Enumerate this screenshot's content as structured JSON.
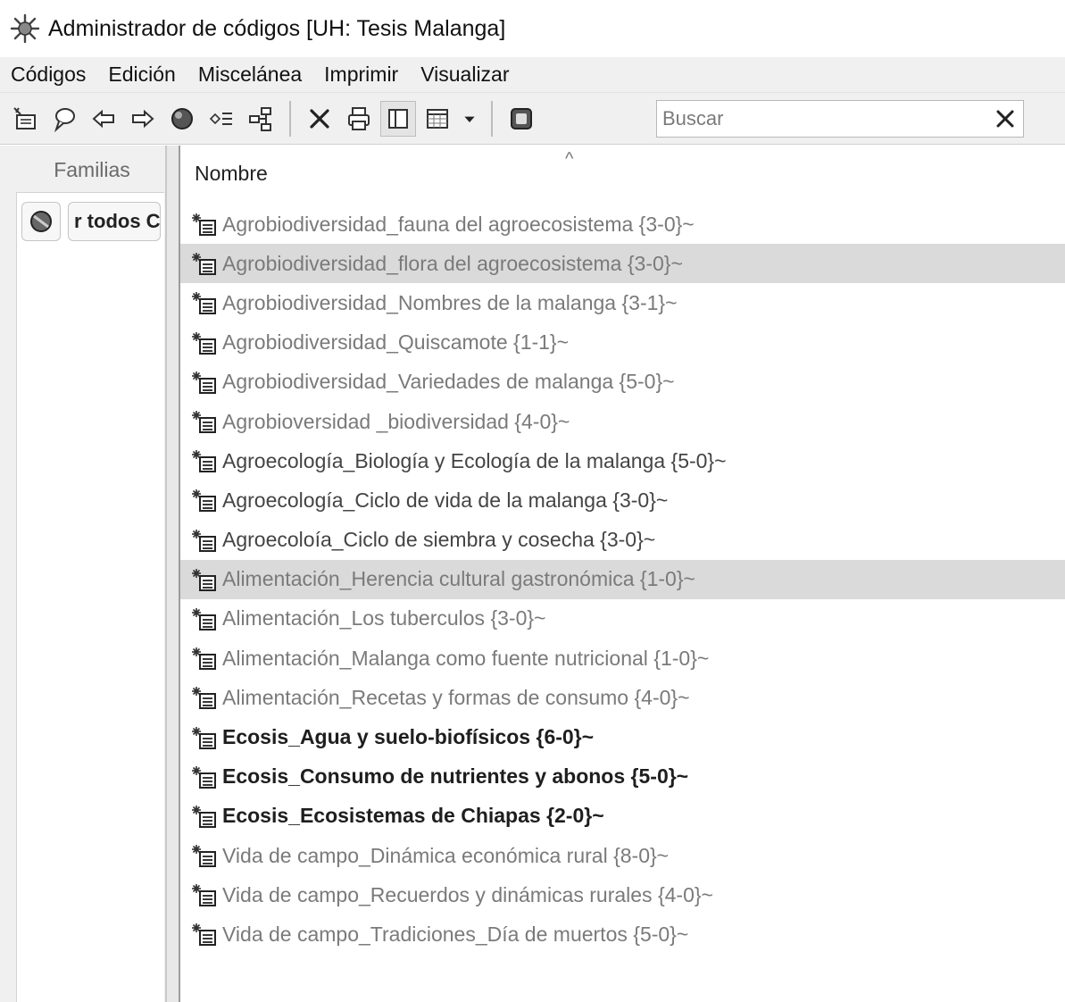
{
  "window": {
    "title": "Administrador de códigos [UH: Tesis Malanga]",
    "icon": "gear-bugs-icon"
  },
  "menu": [
    {
      "label": "Códigos"
    },
    {
      "label": "Edición"
    },
    {
      "label": "Miscelánea"
    },
    {
      "label": "Imprimir"
    },
    {
      "label": "Visualizar"
    }
  ],
  "toolbar": {
    "icons": [
      "new-code-icon",
      "comment-icon",
      "arrow-left-icon",
      "arrow-right-icon",
      "circle-icon",
      "code-list-icon",
      "network-icon",
      "delete-icon",
      "print-icon",
      "split-view-icon",
      "grid-view-icon",
      "dropdown-icon",
      "frame-icon"
    ],
    "search": {
      "placeholder": "Buscar",
      "value": ""
    }
  },
  "families": {
    "header": "Familias",
    "chip_label": "r todos C"
  },
  "codes": {
    "column_header": "Nombre",
    "items": [
      {
        "label": "Agrobiodiversidad_fauna del agroecosistema {3-0}~",
        "style": "gray",
        "selected": false
      },
      {
        "label": "Agrobiodiversidad_flora del agroecosistema {3-0}~",
        "style": "gray",
        "selected": true
      },
      {
        "label": "Agrobiodiversidad_Nombres de la malanga {3-1}~",
        "style": "gray",
        "selected": false
      },
      {
        "label": "Agrobiodiversidad_Quiscamote {1-1}~",
        "style": "gray",
        "selected": false
      },
      {
        "label": "Agrobiodiversidad_Variedades de malanga {5-0}~",
        "style": "gray",
        "selected": false
      },
      {
        "label": "Agrobioversidad _biodiversidad {4-0}~",
        "style": "gray",
        "selected": false
      },
      {
        "label": "Agroecología_Biología y Ecología de la malanga {5-0}~",
        "style": "dark",
        "selected": false
      },
      {
        "label": "Agroecología_Ciclo de vida de la malanga {3-0}~",
        "style": "dark",
        "selected": false
      },
      {
        "label": "Agroecoloía_Ciclo de siembra y cosecha {3-0}~",
        "style": "dark",
        "selected": false
      },
      {
        "label": "Alimentación_Herencia cultural gastronómica {1-0}~",
        "style": "gray",
        "selected": true
      },
      {
        "label": "Alimentación_Los tuberculos {3-0}~",
        "style": "gray",
        "selected": false
      },
      {
        "label": "Alimentación_Malanga como fuente nutricional {1-0}~",
        "style": "gray",
        "selected": false
      },
      {
        "label": "Alimentación_Recetas y formas de consumo {4-0}~",
        "style": "gray",
        "selected": false
      },
      {
        "label": "Ecosis_Agua y suelo-biofísicos {6-0}~",
        "style": "bold",
        "selected": false
      },
      {
        "label": "Ecosis_Consumo de nutrientes y abonos {5-0}~",
        "style": "bold",
        "selected": false
      },
      {
        "label": "Ecosis_Ecosistemas de Chiapas {2-0}~",
        "style": "bold",
        "selected": false
      },
      {
        "label": "Vida de campo_Dinámica económica rural {8-0}~",
        "style": "gray",
        "selected": false
      },
      {
        "label": "Vida de campo_Recuerdos y dinámicas rurales {4-0}~",
        "style": "gray",
        "selected": false
      },
      {
        "label": "Vida de campo_Tradiciones_Día de muertos {5-0}~",
        "style": "gray",
        "selected": false
      }
    ]
  },
  "colors": {
    "selected_row": "#dadada",
    "gray_text": "#7a7a7a",
    "dark_text": "#444444",
    "bold_text": "#1e1e1e",
    "chrome": "#f0f0f0"
  }
}
